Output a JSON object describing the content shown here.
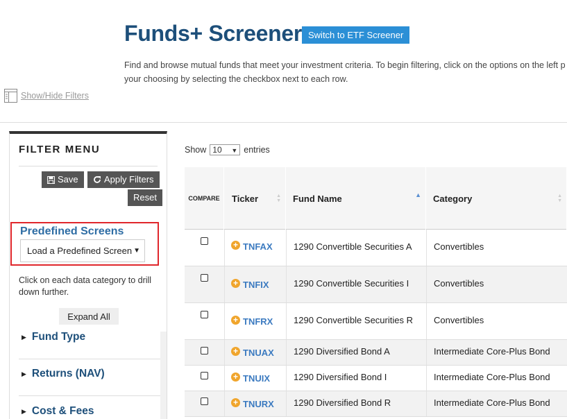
{
  "header": {
    "title": "Funds+ Screener",
    "etf_button": "Switch to ETF Screener",
    "intro_line1": "Find and browse mutual funds that meet your investment criteria. To begin filtering, click on the options on the left p",
    "intro_line2": "your choosing by selecting the checkbox next to each row."
  },
  "toggle_filters_label": "Show/Hide Filters",
  "filter_menu": {
    "title": "FILTER MENU",
    "save_label": "Save",
    "apply_label": "Apply Filters",
    "reset_label": "Reset",
    "predefined_title": "Predefined Screens",
    "predefined_select": "Load a Predefined Screen",
    "drill_text": "Click on each data category to drill down further.",
    "expand_all": "Expand All",
    "categories": [
      "Fund Type",
      "Returns (NAV)",
      "Cost & Fees"
    ]
  },
  "table": {
    "show_label": "Show",
    "entries_value": "10",
    "entries_label": "entries",
    "columns": [
      "COMPARE",
      "Ticker",
      "Fund Name",
      "Category"
    ],
    "rows": [
      {
        "ticker": "TNFAX",
        "fund": "1290 Convertible Securities A",
        "category": "Convertibles"
      },
      {
        "ticker": "TNFIX",
        "fund": "1290 Convertible Securities I",
        "category": "Convertibles"
      },
      {
        "ticker": "TNFRX",
        "fund": "1290 Convertible Securities R",
        "category": "Convertibles"
      },
      {
        "ticker": "TNUAX",
        "fund": "1290 Diversified Bond A",
        "category": "Intermediate Core-Plus Bond"
      },
      {
        "ticker": "TNUIX",
        "fund": "1290 Diversified Bond I",
        "category": "Intermediate Core-Plus Bond"
      },
      {
        "ticker": "TNURX",
        "fund": "1290 Diversified Bond R",
        "category": "Intermediate Core-Plus Bond"
      }
    ]
  },
  "colors": {
    "title": "#1d4f7a",
    "etf_button": "#2b8fd6",
    "ticker_link": "#3b7ac0",
    "plus_icon": "#f0a52c",
    "highlight_border": "#e0262b"
  }
}
